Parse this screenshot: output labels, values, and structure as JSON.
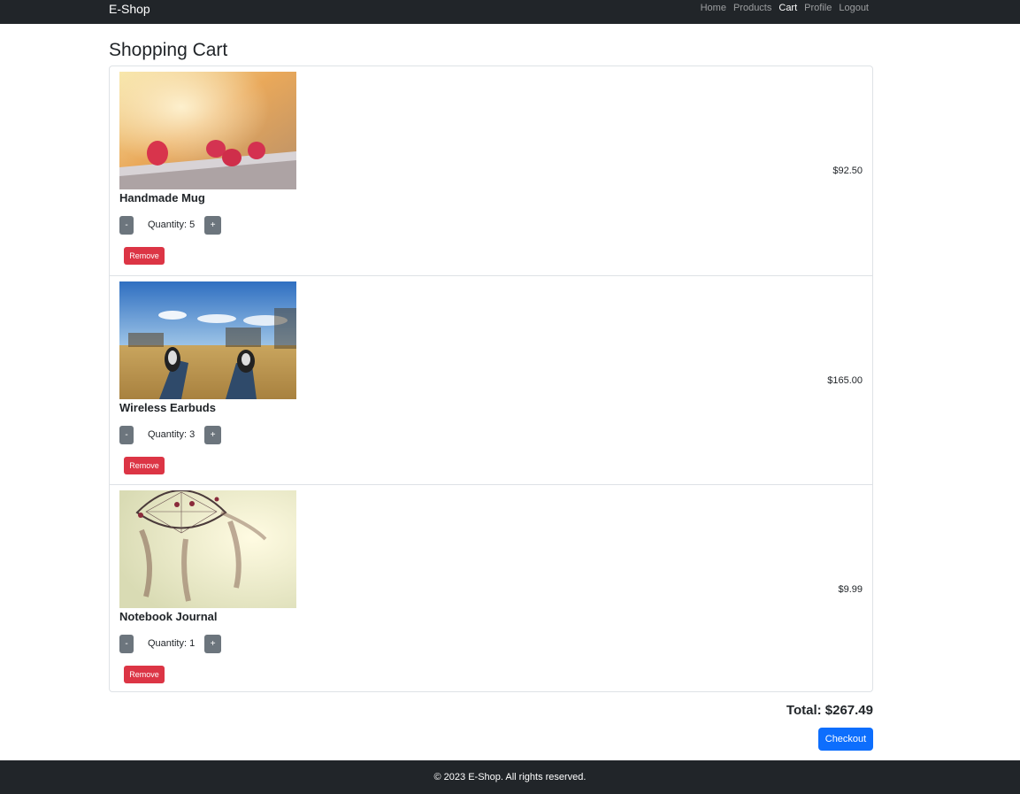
{
  "navbar": {
    "brand": "E-Shop",
    "links": [
      {
        "label": "Home"
      },
      {
        "label": "Products"
      },
      {
        "label": "Cart"
      },
      {
        "label": "Profile"
      },
      {
        "label": "Logout"
      }
    ]
  },
  "page": {
    "title": "Shopping Cart"
  },
  "cart": {
    "items": [
      {
        "name": "Handmade Mug",
        "quantity_text": "Quantity: 5",
        "price": "$92.50",
        "decrement": "-",
        "increment": "+",
        "remove": "Remove"
      },
      {
        "name": "Wireless Earbuds",
        "quantity_text": "Quantity: 3",
        "price": "$165.00",
        "decrement": "-",
        "increment": "+",
        "remove": "Remove"
      },
      {
        "name": "Notebook Journal",
        "quantity_text": "Quantity: 1",
        "price": "$9.99",
        "decrement": "-",
        "increment": "+",
        "remove": "Remove"
      }
    ],
    "total": "Total: $267.49",
    "checkout": "Checkout"
  },
  "footer": {
    "text": "© 2023 E-Shop. All rights reserved."
  },
  "colors": {
    "navbar": "#212529",
    "secondary_button": "#6c757d",
    "danger_button": "#dc3545",
    "primary_button": "#0d6efd"
  }
}
